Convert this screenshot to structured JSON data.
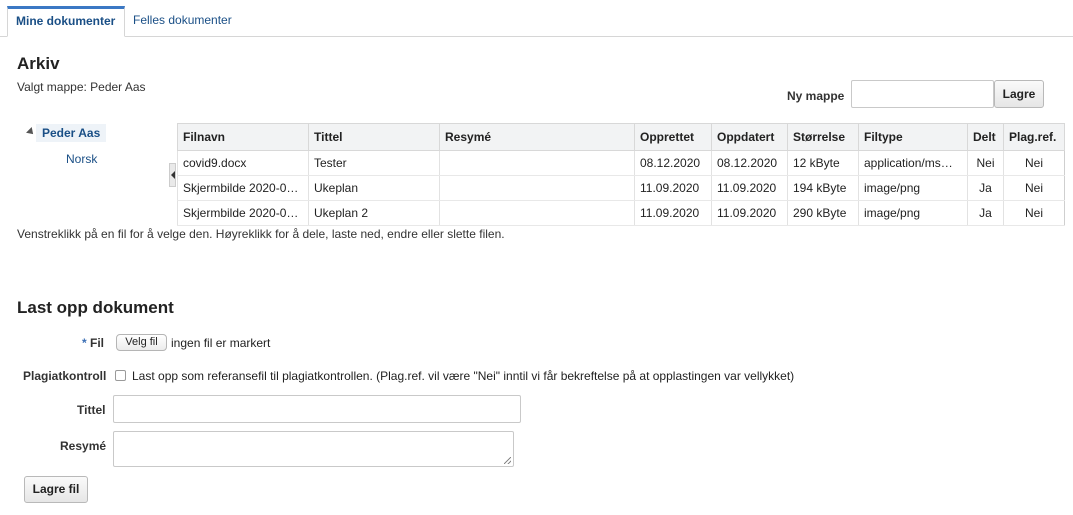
{
  "tabs": [
    {
      "label": "Mine dokumenter",
      "active": true
    },
    {
      "label": "Felles dokumenter",
      "active": false
    }
  ],
  "archive": {
    "title": "Arkiv",
    "selected_folder": "Valgt mappe: Peder Aas",
    "new_folder_label": "Ny mappe",
    "new_folder_value": "",
    "save_label": "Lagre"
  },
  "tree": {
    "root": "Peder Aas",
    "children": [
      "Norsk"
    ]
  },
  "files_table": {
    "columns": [
      "Filnavn",
      "Tittel",
      "Resymé",
      "Opprettet",
      "Oppdatert",
      "Størrelse",
      "Filtype",
      "Delt",
      "Plag.ref."
    ],
    "rows": [
      {
        "filename": "covid9.docx",
        "title": "Tester",
        "summary": "",
        "created": "08.12.2020",
        "updated": "08.12.2020",
        "size": "12 kByte",
        "type": "application/ms…",
        "shared": "Nei",
        "plagref": "Nei"
      },
      {
        "filename": "Skjermbilde 2020-0…",
        "title": "Ukeplan",
        "summary": "",
        "created": "11.09.2020",
        "updated": "11.09.2020",
        "size": "194 kByte",
        "type": "image/png",
        "shared": "Ja",
        "plagref": "Nei"
      },
      {
        "filename": "Skjermbilde 2020-0…",
        "title": "Ukeplan 2",
        "summary": "",
        "created": "11.09.2020",
        "updated": "11.09.2020",
        "size": "290 kByte",
        "type": "image/png",
        "shared": "Ja",
        "plagref": "Nei"
      }
    ]
  },
  "hint": "Venstreklikk på en fil for å velge den. Høyreklikk for å dele, laste ned, endre eller slette filen.",
  "upload": {
    "title": "Last opp dokument",
    "required_mark": "*",
    "file_label": "Fil",
    "choose_file_label": "Velg fil",
    "no_file_text": "ingen fil er markert",
    "plagiarism_label": "Plagiatkontroll",
    "plagiarism_checkbox_text": "Last opp som referansefil til plagiatkontrollen. (Plag.ref. vil være \"Nei\" inntil vi får bekreftelse på at opplastingen var vellykket)",
    "plagiarism_checked": false,
    "title_label": "Tittel",
    "title_value": "",
    "summary_label": "Resymé",
    "summary_value": "",
    "save_file_label": "Lagre fil"
  }
}
